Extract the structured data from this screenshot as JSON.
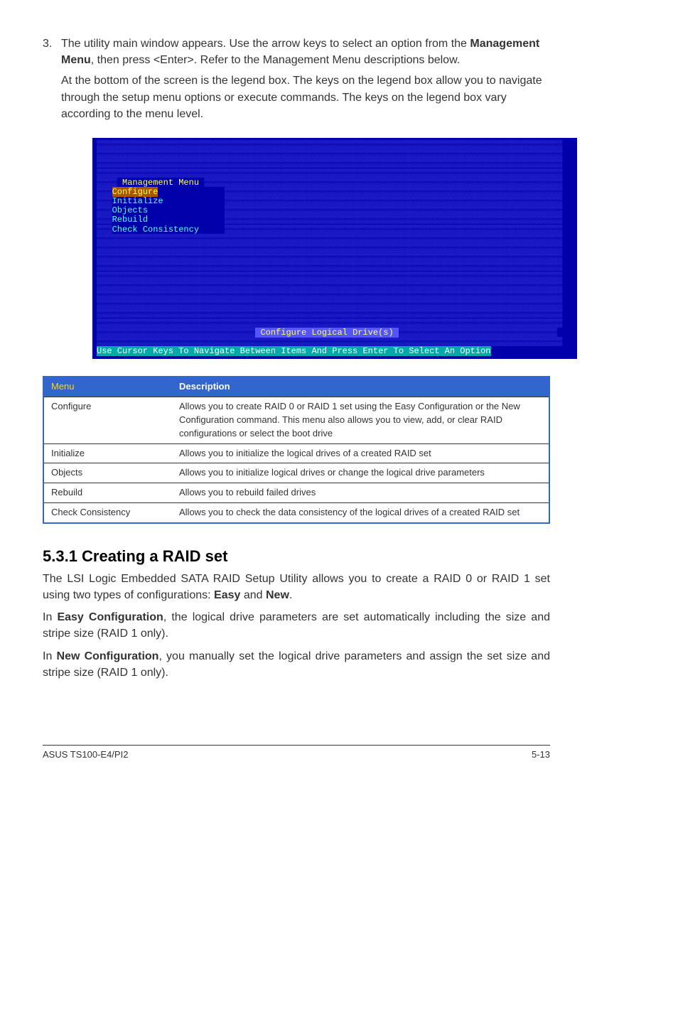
{
  "step": {
    "number": "3.",
    "para1_prefix": "The utility main window appears. Use the arrow keys to select an option from the ",
    "para1_bold": "Management Menu",
    "para1_suffix": ", then press <Enter>. Refer to the Management Menu descriptions below.",
    "para2": "At the bottom of the screen is the legend box. The keys on the legend box allow you to navigate through the setup menu options or execute commands. The keys on the legend box vary according to the menu level."
  },
  "console": {
    "menu_header": " Management Menu ",
    "items": {
      "configure": "Configure",
      "initialize": "Initialize",
      "objects": "Objects",
      "rebuild": "Rebuild",
      "check": "Check Consistency"
    },
    "status": " Configure Logical Drive(s) ",
    "footer": "Use Cursor Keys To Navigate Between Items And Press Enter To Select An Option"
  },
  "table": {
    "headers": {
      "menu": "Menu",
      "desc": "Description"
    },
    "rows": [
      {
        "menu": "Configure",
        "desc": "Allows you to create RAID 0 or RAID 1 set using the Easy Configuration or the New Configuration command. This menu also allows you to view, add, or clear RAID configurations or select the boot drive"
      },
      {
        "menu": "Initialize",
        "desc": "Allows you to initialize the logical drives of a created RAID set"
      },
      {
        "menu": "Objects",
        "desc": "Allows you to initialize logical drives or change the logical drive parameters"
      },
      {
        "menu": "Rebuild",
        "desc": "Allows you to rebuild failed drives"
      },
      {
        "menu": "Check Consistency",
        "desc": "Allows you to check the data consistency of the logical drives of a created RAID set"
      }
    ]
  },
  "section": {
    "heading": "5.3.1 Creating a RAID set",
    "p1_prefix": "The LSI Logic Embedded SATA RAID Setup Utility allows you to create a RAID 0 or RAID 1 set using two types of configurations: ",
    "p1_b1": "Easy",
    "p1_mid": " and ",
    "p1_b2": "New",
    "p1_suffix": ".",
    "p2_prefix": "In ",
    "p2_bold": "Easy Configuration",
    "p2_suffix": ", the logical drive parameters are set automatically including the size and stripe size (RAID 1 only).",
    "p3_prefix": "In ",
    "p3_bold": "New Configuration",
    "p3_suffix": ", you manually set the logical drive parameters and assign the set size and stripe size (RAID 1 only)."
  },
  "footer": {
    "left": "ASUS TS100-E4/PI2",
    "right": "5-13"
  }
}
